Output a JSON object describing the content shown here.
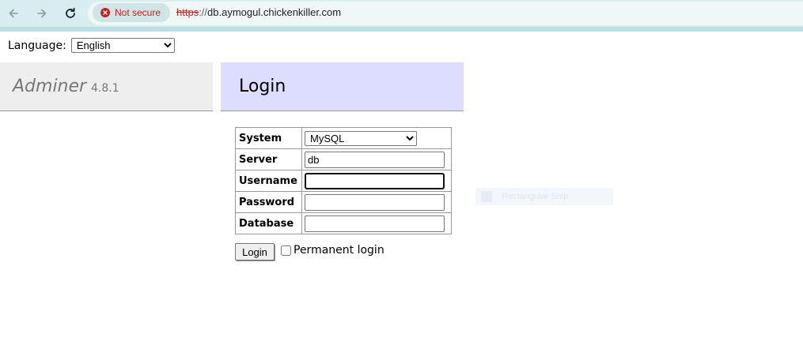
{
  "browser": {
    "security_label": "Not secure",
    "url_scheme": "https",
    "url_separator": "://",
    "url_host": "db.aymogul.chickenkiller.com"
  },
  "language": {
    "label": "Language:",
    "selected": "English"
  },
  "header": {
    "app_name": "Adminer",
    "version": "4.8.1",
    "page_title": "Login"
  },
  "form": {
    "fields": [
      {
        "label": "System",
        "value": "MySQL"
      },
      {
        "label": "Server",
        "value": "db"
      },
      {
        "label": "Username",
        "value": ""
      },
      {
        "label": "Password",
        "value": ""
      },
      {
        "label": "Database",
        "value": ""
      }
    ],
    "submit_label": "Login",
    "permanent_login_label": "Permanent login",
    "permanent_login_checked": false
  },
  "overlay": {
    "ghost_text": "Rectangular Snip"
  },
  "colors": {
    "browser_bar": "#d8eeee",
    "insecure_red": "#c5221f",
    "adminer_header_bg": "#eeeeee",
    "login_header_bg": "#ddddff"
  }
}
